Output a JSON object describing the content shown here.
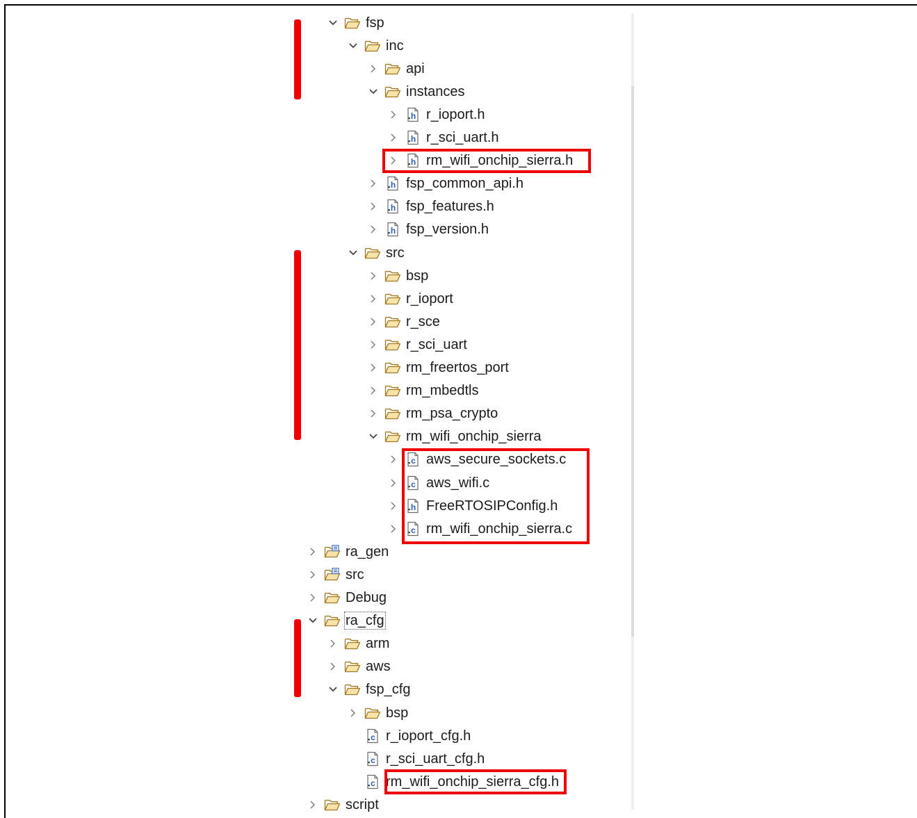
{
  "tree": {
    "rows": [
      {
        "label": "fsp",
        "caret": "expanded",
        "icon": "folder-open-icon"
      },
      {
        "label": "inc",
        "caret": "expanded",
        "icon": "folder-open-icon"
      },
      {
        "label": "api",
        "caret": "collapsed",
        "icon": "folder-open-icon"
      },
      {
        "label": "instances",
        "caret": "expanded",
        "icon": "folder-open-icon"
      },
      {
        "label": "r_ioport.h",
        "caret": "collapsed",
        "icon": "header-file-icon"
      },
      {
        "label": "r_sci_uart.h",
        "caret": "collapsed",
        "icon": "header-file-icon"
      },
      {
        "label": "rm_wifi_onchip_sierra.h",
        "caret": "collapsed",
        "icon": "header-file-icon"
      },
      {
        "label": "fsp_common_api.h",
        "caret": "collapsed",
        "icon": "header-file-icon"
      },
      {
        "label": "fsp_features.h",
        "caret": "collapsed",
        "icon": "header-file-icon"
      },
      {
        "label": "fsp_version.h",
        "caret": "collapsed",
        "icon": "header-file-icon"
      },
      {
        "label": "src",
        "caret": "expanded",
        "icon": "folder-open-icon"
      },
      {
        "label": "bsp",
        "caret": "collapsed",
        "icon": "folder-open-icon"
      },
      {
        "label": "r_ioport",
        "caret": "collapsed",
        "icon": "folder-open-icon"
      },
      {
        "label": "r_sce",
        "caret": "collapsed",
        "icon": "folder-open-icon"
      },
      {
        "label": "r_sci_uart",
        "caret": "collapsed",
        "icon": "folder-open-icon"
      },
      {
        "label": "rm_freertos_port",
        "caret": "collapsed",
        "icon": "folder-open-icon"
      },
      {
        "label": "rm_mbedtls",
        "caret": "collapsed",
        "icon": "folder-open-icon"
      },
      {
        "label": "rm_psa_crypto",
        "caret": "collapsed",
        "icon": "folder-open-icon"
      },
      {
        "label": "rm_wifi_onchip_sierra",
        "caret": "expanded",
        "icon": "folder-open-icon"
      },
      {
        "label": "aws_secure_sockets.c",
        "caret": "collapsed",
        "icon": "c-file-icon"
      },
      {
        "label": "aws_wifi.c",
        "caret": "collapsed",
        "icon": "c-file-icon"
      },
      {
        "label": "FreeRTOSIPConfig.h",
        "caret": "collapsed",
        "icon": "header-file-icon"
      },
      {
        "label": "rm_wifi_onchip_sierra.c",
        "caret": "collapsed",
        "icon": "c-file-icon"
      },
      {
        "label": "ra_gen",
        "caret": "collapsed",
        "icon": "source-folder-icon"
      },
      {
        "label": "src",
        "caret": "collapsed",
        "icon": "source-folder-icon"
      },
      {
        "label": "Debug",
        "caret": "collapsed",
        "icon": "folder-open-icon"
      },
      {
        "label": "ra_cfg",
        "caret": "expanded",
        "icon": "folder-open-icon"
      },
      {
        "label": "arm",
        "caret": "collapsed",
        "icon": "folder-open-icon"
      },
      {
        "label": "aws",
        "caret": "collapsed",
        "icon": "folder-open-icon"
      },
      {
        "label": "fsp_cfg",
        "caret": "expanded",
        "icon": "folder-open-icon"
      },
      {
        "label": "bsp",
        "caret": "collapsed",
        "icon": "folder-open-icon"
      },
      {
        "label": "r_ioport_cfg.h",
        "caret": "none",
        "icon": "c-file-icon"
      },
      {
        "label": "r_sci_uart_cfg.h",
        "caret": "none",
        "icon": "c-file-icon"
      },
      {
        "label": "rm_wifi_onchip_sierra_cfg.h",
        "caret": "none",
        "icon": "c-file-icon"
      },
      {
        "label": "script",
        "caret": "collapsed",
        "icon": "folder-open-icon"
      }
    ]
  },
  "colors": {
    "highlight_red": "#ee0000",
    "folder_outline": "#a0782a",
    "folder_fill": "#f8e3a8",
    "file_icon_blue": "#2b5fb0"
  }
}
